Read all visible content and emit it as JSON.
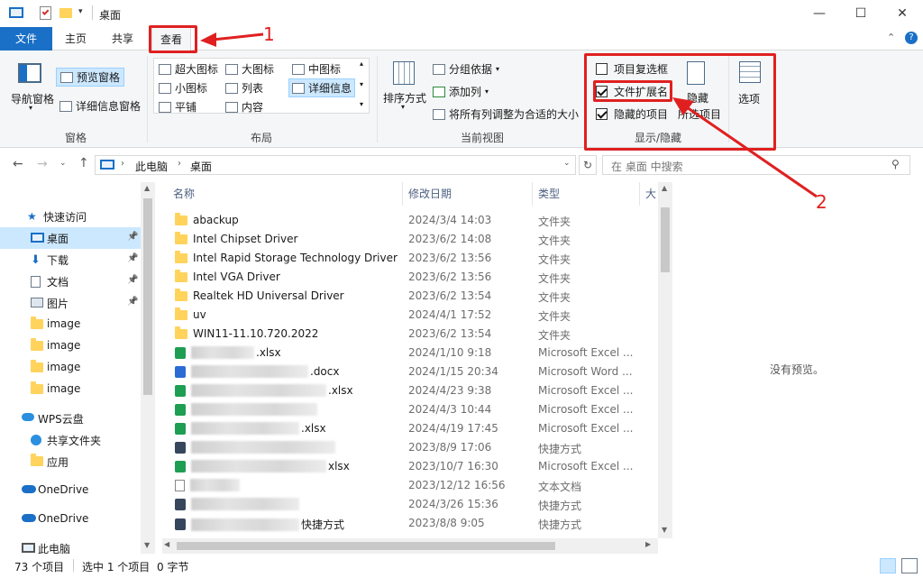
{
  "window": {
    "title": "桌面"
  },
  "ribbon_tabs": [
    "文件",
    "主页",
    "共享",
    "查看"
  ],
  "ribbon": {
    "pane_group": {
      "label": "窗格",
      "nav_pane": "导航窗格",
      "preview_pane": "预览窗格",
      "details_pane": "详细信息窗格"
    },
    "layout_group": {
      "label": "布局",
      "items": [
        "超大图标",
        "大图标",
        "中图标",
        "小图标",
        "列表",
        "详细信息",
        "平铺",
        "内容"
      ]
    },
    "current_view_group": {
      "label": "当前视图",
      "sort_by": "排序方式",
      "group_by": "分组依据",
      "add_columns": "添加列",
      "fit_columns": "将所有列调整为合适的大小"
    },
    "show_hide_group": {
      "label": "显示/隐藏",
      "item_checkboxes": {
        "label": "项目复选框",
        "checked": false
      },
      "file_extensions": {
        "label": "文件扩展名",
        "checked": true
      },
      "hidden_items": {
        "label": "隐藏的项目",
        "checked": true
      },
      "hide_selected": "隐藏",
      "hide_selected_line2": "所选项目"
    },
    "options": "选项"
  },
  "address": {
    "crumbs": [
      "此电脑",
      "桌面"
    ],
    "search_placeholder": "在 桌面 中搜索"
  },
  "nav": [
    {
      "label": "快速访问",
      "icon": "star-icon"
    },
    {
      "label": "桌面",
      "icon": "desktop-icon",
      "pinned": true,
      "selected": true
    },
    {
      "label": "下载",
      "icon": "download-icon",
      "pinned": true
    },
    {
      "label": "文档",
      "icon": "document-icon",
      "pinned": true
    },
    {
      "label": "图片",
      "icon": "picture-icon",
      "pinned": true
    },
    {
      "label": "image",
      "icon": "folder-icon"
    },
    {
      "label": "image",
      "icon": "folder-icon"
    },
    {
      "label": "image",
      "icon": "folder-icon"
    },
    {
      "label": "image",
      "icon": "folder-icon"
    },
    {
      "label": "WPS云盘",
      "icon": "cloud-icon"
    },
    {
      "label": "共享文件夹",
      "icon": "share-icon"
    },
    {
      "label": "应用",
      "icon": "folder-icon"
    },
    {
      "label": "OneDrive",
      "icon": "onedrive-icon"
    },
    {
      "label": "OneDrive",
      "icon": "onedrive-icon"
    },
    {
      "label": "此电脑",
      "icon": "pc-icon"
    }
  ],
  "columns": [
    "名称",
    "修改日期",
    "类型",
    "大"
  ],
  "files": [
    {
      "name": "abackup",
      "date": "2024/3/4 14:03",
      "type": "文件夹",
      "icon": "folder"
    },
    {
      "name": "Intel Chipset Driver",
      "date": "2023/6/2 14:08",
      "type": "文件夹",
      "icon": "folder"
    },
    {
      "name": "Intel Rapid Storage Technology Driver",
      "date": "2023/6/2 13:56",
      "type": "文件夹",
      "icon": "folder"
    },
    {
      "name": "Intel VGA Driver",
      "date": "2023/6/2 13:56",
      "type": "文件夹",
      "icon": "folder"
    },
    {
      "name": "Realtek HD Universal Driver",
      "date": "2023/6/2 13:54",
      "type": "文件夹",
      "icon": "folder"
    },
    {
      "name": "uv",
      "date": "2024/4/1 17:52",
      "type": "文件夹",
      "icon": "folder"
    },
    {
      "name": "WIN11-11.10.720.2022",
      "date": "2023/6/2 13:54",
      "type": "文件夹",
      "icon": "folder"
    },
    {
      "name": ".xlsx",
      "date": "2024/1/10 9:18",
      "type": "Microsoft Excel ...",
      "icon": "excel"
    },
    {
      "name": ".docx",
      "date": "2024/1/15 20:34",
      "type": "Microsoft Word ...",
      "icon": "word"
    },
    {
      "name": ".xlsx",
      "date": "2024/4/23 9:38",
      "type": "Microsoft Excel ...",
      "icon": "excel"
    },
    {
      "name": "",
      "date": "2024/4/3 10:44",
      "type": "Microsoft Excel ...",
      "icon": "excel"
    },
    {
      "name": ".xlsx",
      "date": "2024/4/19 17:45",
      "type": "Microsoft Excel ...",
      "icon": "excel"
    },
    {
      "name": "",
      "date": "2023/8/9 17:06",
      "type": "快捷方式",
      "icon": "shortcut"
    },
    {
      "name": "xlsx",
      "date": "2023/10/7 16:30",
      "type": "Microsoft Excel ...",
      "icon": "excel"
    },
    {
      "name": "",
      "date": "2023/12/12 16:56",
      "type": "文本文档",
      "icon": "text"
    },
    {
      "name": "",
      "date": "2024/3/26 15:36",
      "type": "快捷方式",
      "icon": "shortcut"
    },
    {
      "name": "快捷方式",
      "date": "2023/8/8 9:05",
      "type": "快捷方式",
      "icon": "shortcut"
    }
  ],
  "preview_text": "没有预览。",
  "status": {
    "count": "73 个项目",
    "selected": "选中 1 个项目",
    "size": "0 字节"
  },
  "annotations": [
    "1",
    "2"
  ],
  "accent": "#1a6fc6",
  "annotation_color": "#e02020"
}
